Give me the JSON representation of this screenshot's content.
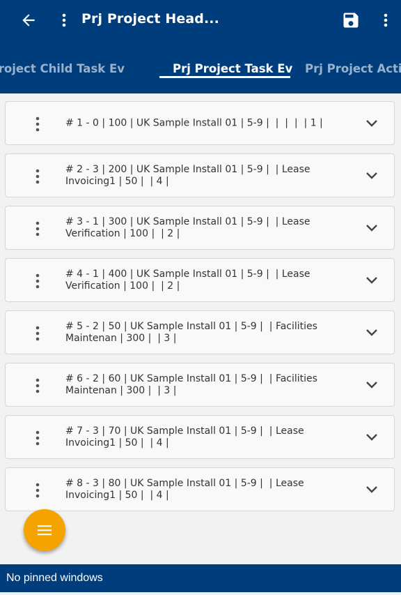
{
  "header": {
    "title": "Prj Project Head...",
    "back_icon": "arrow-left-icon",
    "menu_icon": "kebab-vertical-icon",
    "save_icon": "floppy-disk-icon",
    "overflow_icon": "kebab-vertical-icon"
  },
  "tabs": [
    {
      "label": "Prj Project Child Task Ev",
      "visible_text": "t Child Task Ev",
      "active": false
    },
    {
      "label": "Prj Project Task Ev",
      "visible_text": "Prj Project Task Ev",
      "active": true
    },
    {
      "label": "Prj Project Activity",
      "visible_text": "Prj Project Activ",
      "active": false
    }
  ],
  "rows": [
    {
      "text": "# 1 - 0 | 100 | UK Sample Install 01 | 5-9 |  |  |  |  | 1 |"
    },
    {
      "text": "# 2 - 3 | 200 | UK Sample Install 01 | 5-9 |  | Lease Invoicing1 | 50 |  | 4 |"
    },
    {
      "text": "# 3 - 1 | 300 | UK Sample Install 01 | 5-9 |  | Lease Verification | 100 |  | 2 |"
    },
    {
      "text": "# 4 - 1 | 400 | UK Sample Install 01 | 5-9 |  | Lease Verification | 100 |  | 2 |"
    },
    {
      "text": "# 5 - 2 | 50 | UK Sample Install 01 | 5-9 |  | Facilities Maintenan | 300 |  | 3 |"
    },
    {
      "text": "# 6 - 2 | 60 | UK Sample Install 01 | 5-9 |  | Facilities Maintenan | 300 |  | 3 |"
    },
    {
      "text": "# 7 - 3 | 70 | UK Sample Install 01 | 5-9 |  | Lease Invoicing1 | 50 |  | 4 |"
    },
    {
      "text": "# 8 - 3 | 80 | UK Sample Install 01 | 5-9 |  | Lease Invoicing1 | 50 |  | 4 |"
    }
  ],
  "fab": {
    "icon": "menu-lines-icon"
  },
  "footer": {
    "text": "No pinned windows"
  },
  "colors": {
    "primary": "#003d7c",
    "accent": "#f5a300",
    "background": "#f2f2f2",
    "card": "#f9f9f9"
  }
}
